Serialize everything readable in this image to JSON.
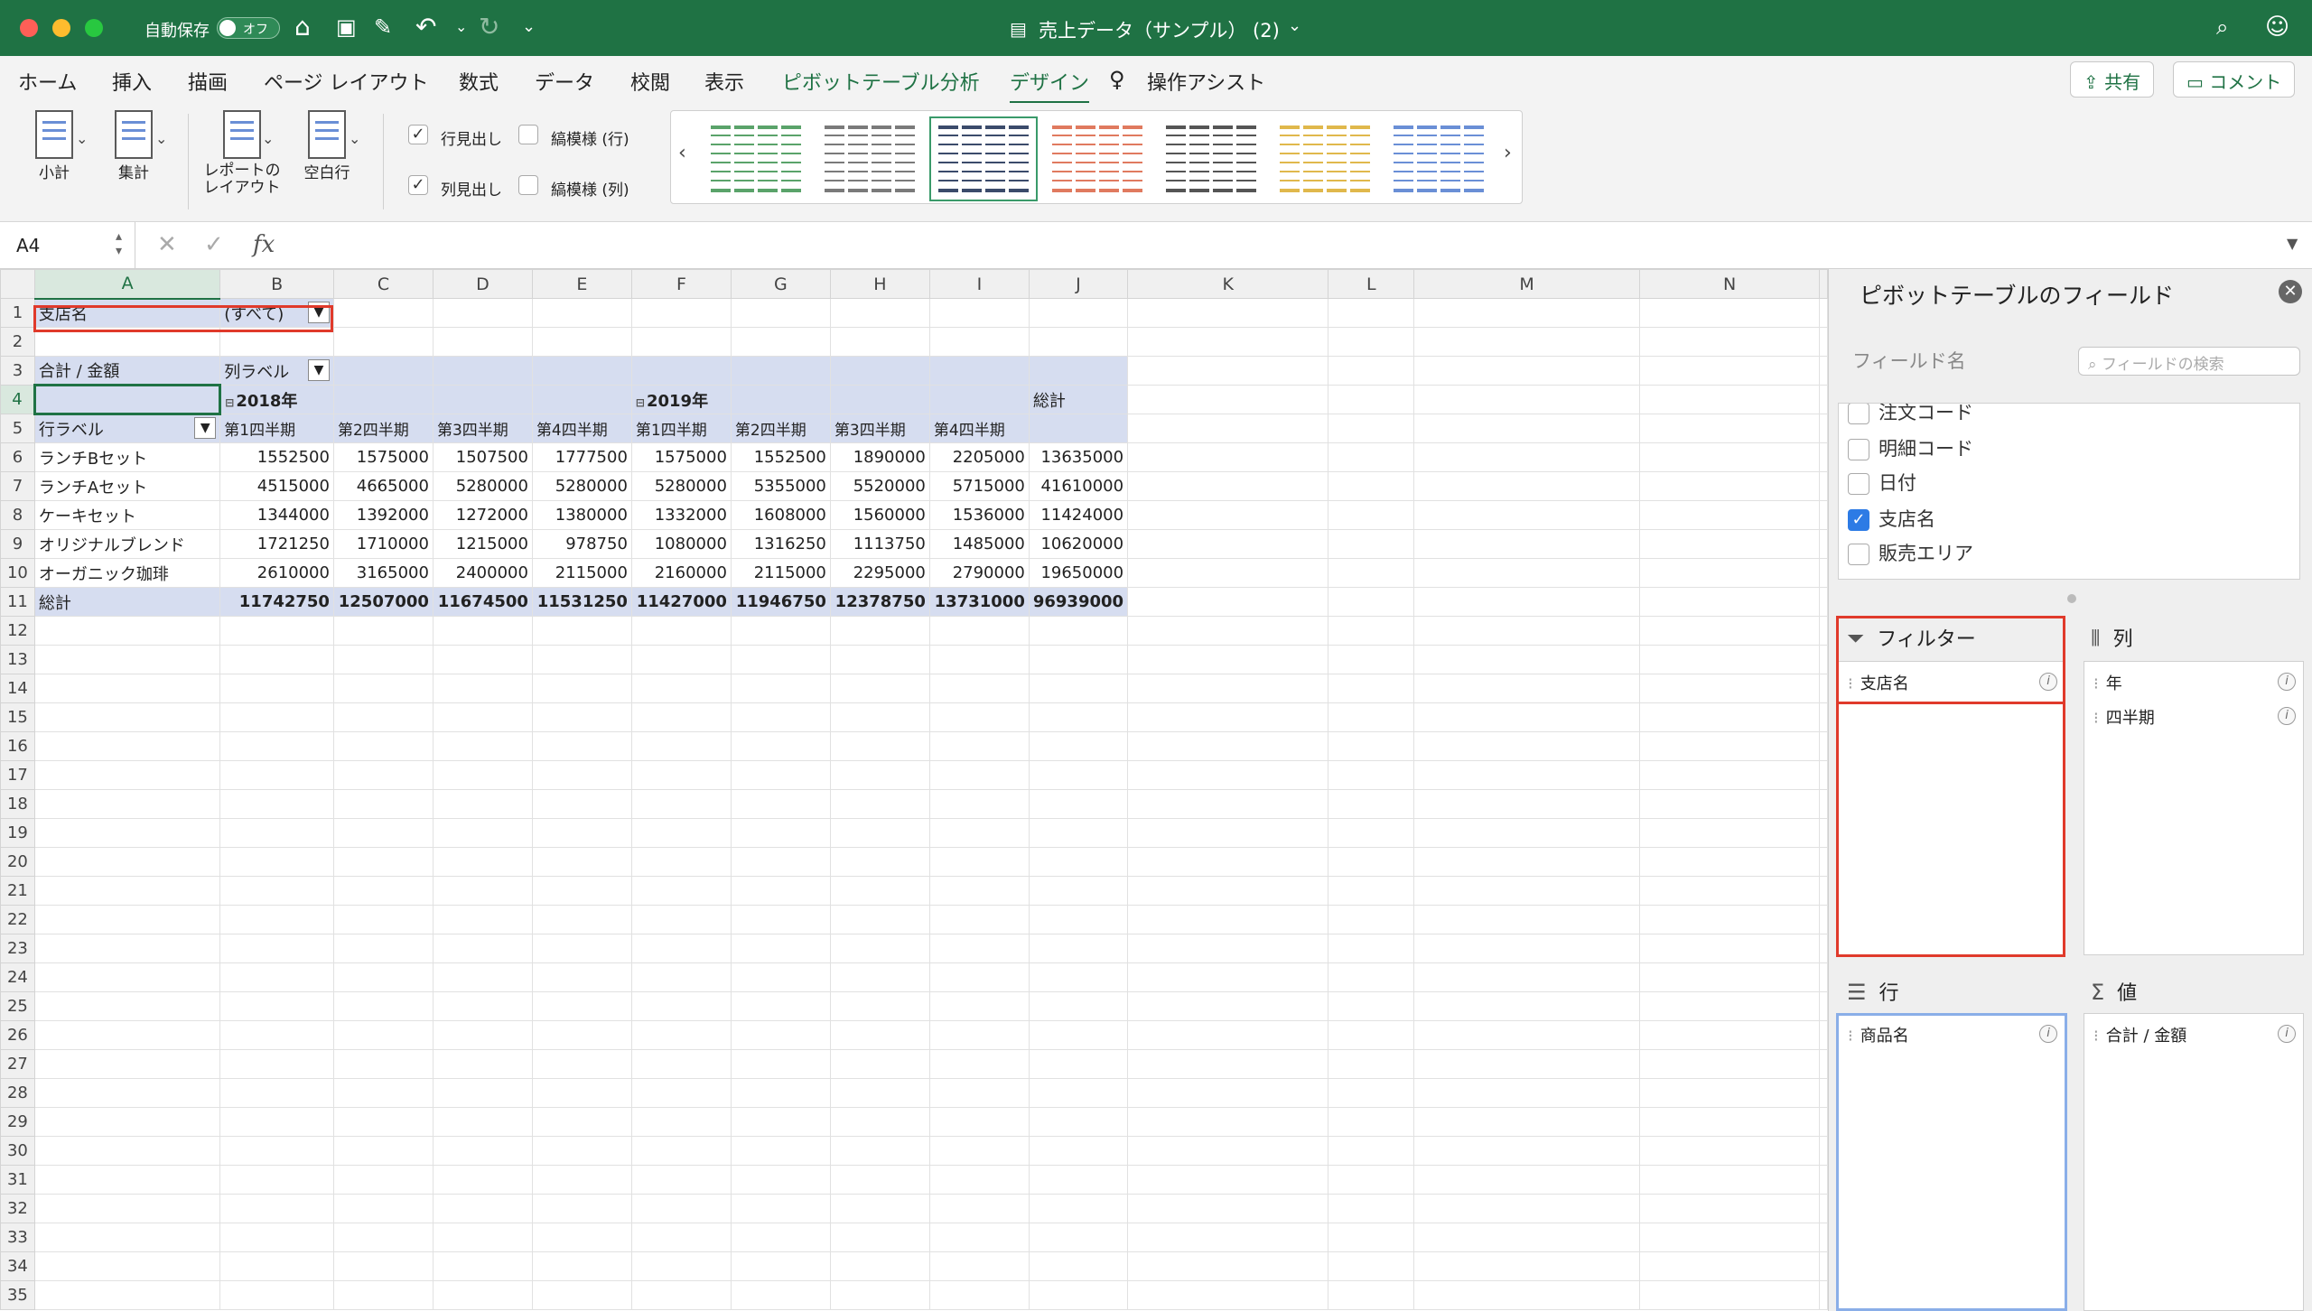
{
  "titlebar": {
    "autosave_label": "自動保存",
    "autosave_state": "オフ",
    "doc_title": "売上データ（サンプル） (2)",
    "doc_caret": "⌄"
  },
  "menu": {
    "tabs": [
      "ホーム",
      "挿入",
      "描画",
      "ページ レイアウト",
      "数式",
      "データ",
      "校閲",
      "表示",
      "ピボットテーブル分析",
      "デザイン"
    ],
    "assist": "操作アシスト",
    "share": "共有",
    "comment": "コメント"
  },
  "ribbon": {
    "subtotal": "小計",
    "grandtotal": "集計",
    "report_layout_1": "レポートの",
    "report_layout_2": "レイアウト",
    "blank_row": "空白行",
    "row_headers": "行見出し",
    "col_headers": "列見出し",
    "banded_rows": "縞模様 (行)",
    "banded_cols": "縞模様 (列)",
    "style_colors": [
      "#5aa36a",
      "#7a7a7a",
      "#3b4b6b",
      "#e07a5f",
      "#555555",
      "#e0b84c",
      "#6a8fd6"
    ]
  },
  "formula": {
    "cell_ref": "A4",
    "fx": "fx"
  },
  "sheet": {
    "columns": [
      "A",
      "B",
      "C",
      "D",
      "E",
      "F",
      "G",
      "H",
      "I",
      "J",
      "K",
      "L",
      "M",
      "N"
    ],
    "rows": [
      "1",
      "2",
      "3",
      "4",
      "5",
      "6",
      "7",
      "8",
      "9",
      "10",
      "11",
      "12",
      "13",
      "14",
      "15",
      "16",
      "17",
      "18",
      "19",
      "20",
      "21",
      "22",
      "23",
      "24",
      "25",
      "26",
      "27",
      "28",
      "29",
      "30",
      "31",
      "32",
      "33",
      "34",
      "35"
    ],
    "filter_label": "支店名",
    "filter_value": "(すべて)",
    "sum_label": "合計 / 金額",
    "col_labels": "列ラベル",
    "row_labels": "行ラベル",
    "year1": "2018年",
    "year2": "2019年",
    "grand_total_hdr": "総計",
    "quarters": [
      "第1四半期",
      "第2四半期",
      "第3四半期",
      "第4四半期",
      "第1四半期",
      "第2四半期",
      "第3四半期",
      "第4四半期"
    ],
    "data_rows": [
      {
        "name": "ランチBセット",
        "values": [
          "1552500",
          "1575000",
          "1507500",
          "1777500",
          "1575000",
          "1552500",
          "1890000",
          "2205000",
          "13635000"
        ]
      },
      {
        "name": "ランチAセット",
        "values": [
          "4515000",
          "4665000",
          "5280000",
          "5280000",
          "5280000",
          "5355000",
          "5520000",
          "5715000",
          "41610000"
        ]
      },
      {
        "name": "ケーキセット",
        "values": [
          "1344000",
          "1392000",
          "1272000",
          "1380000",
          "1332000",
          "1608000",
          "1560000",
          "1536000",
          "11424000"
        ]
      },
      {
        "name": "オリジナルブレンド",
        "values": [
          "1721250",
          "1710000",
          "1215000",
          "978750",
          "1080000",
          "1316250",
          "1113750",
          "1485000",
          "10620000"
        ]
      },
      {
        "name": "オーガニック珈琲",
        "values": [
          "2610000",
          "3165000",
          "2400000",
          "2115000",
          "2160000",
          "2115000",
          "2295000",
          "2790000",
          "19650000"
        ]
      }
    ],
    "total_row": {
      "name": "総計",
      "values": [
        "11742750",
        "12507000",
        "11674500",
        "11531250",
        "11427000",
        "11946750",
        "12378750",
        "13731000",
        "96939000"
      ]
    }
  },
  "panel": {
    "title": "ピボットテーブルのフィールド",
    "field_name": "フィールド名",
    "search_placeholder": "フィールドの検索",
    "fields": [
      {
        "label": "注文コード",
        "checked": false
      },
      {
        "label": "明細コード",
        "checked": false
      },
      {
        "label": "日付",
        "checked": false
      },
      {
        "label": "支店名",
        "checked": true
      },
      {
        "label": "販売エリア",
        "checked": false
      }
    ],
    "filters_hdr": "フィルター",
    "columns_hdr": "列",
    "rows_hdr": "行",
    "values_hdr": "値",
    "filter_items": [
      "支店名"
    ],
    "column_items": [
      "年",
      "四半期"
    ],
    "row_items": [
      "商品名"
    ],
    "value_items": [
      "合計 / 金額"
    ]
  },
  "colors": {
    "excel_green": "#1f7244",
    "pivot_band": "#d6ddf0",
    "highlight_red": "#e03a2b",
    "checkbox_blue": "#2d7be5"
  }
}
